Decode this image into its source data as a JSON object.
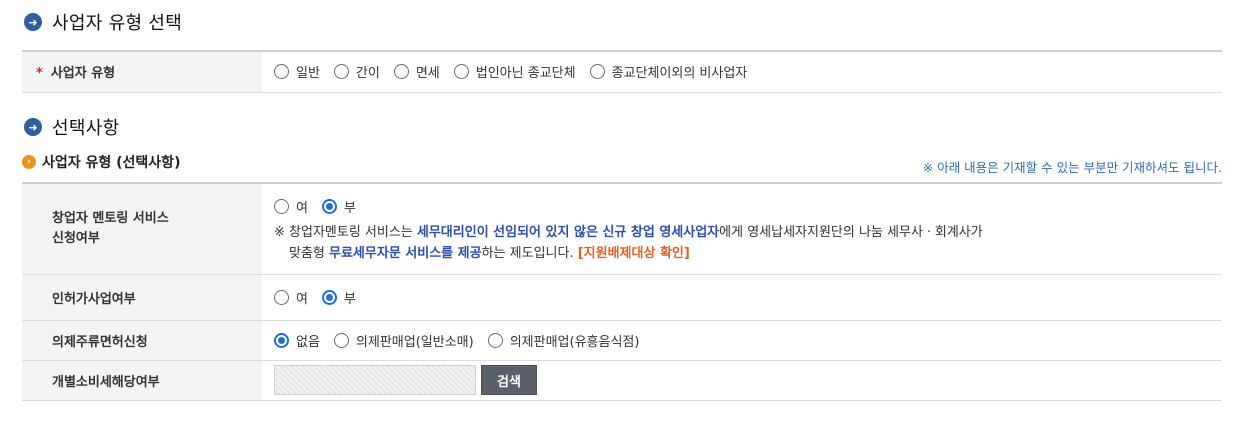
{
  "section1": {
    "title": "사업자 유형 선택",
    "field_label": "사업자 유형",
    "required_mark": "*",
    "options": [
      "일반",
      "간이",
      "면세",
      "법인아닌 종교단체",
      "종교단체이외의 비사업자"
    ]
  },
  "section2": {
    "title": "선택사항",
    "sub_title": "사업자 유형 (선택사항)",
    "notice": "※ 아래 내용은 기재할 수 있는 부분만 기재하셔도 됩니다.",
    "rows": {
      "mentoring": {
        "label_line1": "창업자 멘토링 서비스",
        "label_line2": "신청여부",
        "options": [
          "여",
          "부"
        ],
        "selected": "부",
        "note_prefix": "※ 창업자멘토링 서비스는 ",
        "note_highlight1": "세무대리인이 선임되어 있지 않은 신규 창업 영세사업자",
        "note_mid": "에게 영세납세자지원단의 나눔 세무사ㆍ회계사가",
        "note_line2_prefix": "맞춤형 ",
        "note_highlight2": "무료세무자문 서비스를 제공",
        "note_line2_mid": "하는 제도입니다. ",
        "note_warn": "[지원배제대상 확인]"
      },
      "license": {
        "label": "인허가사업여부",
        "options": [
          "여",
          "부"
        ],
        "selected": "부"
      },
      "liquor": {
        "label": "의제주류면허신청",
        "options": [
          "없음",
          "의제판매업(일반소매)",
          "의제판매업(유흥음식점)"
        ],
        "selected": "없음"
      },
      "consumption_tax": {
        "label": "개별소비세해당여부",
        "button_label": "검색"
      }
    }
  },
  "colors": {
    "accent_blue": "#2f5f9e",
    "radio_checked": "#1f6fd6",
    "highlight_text": "#2d4fa8",
    "warn_text": "#e0622a",
    "notice_text": "#2f6db5",
    "button_bg": "#5a5f68"
  }
}
